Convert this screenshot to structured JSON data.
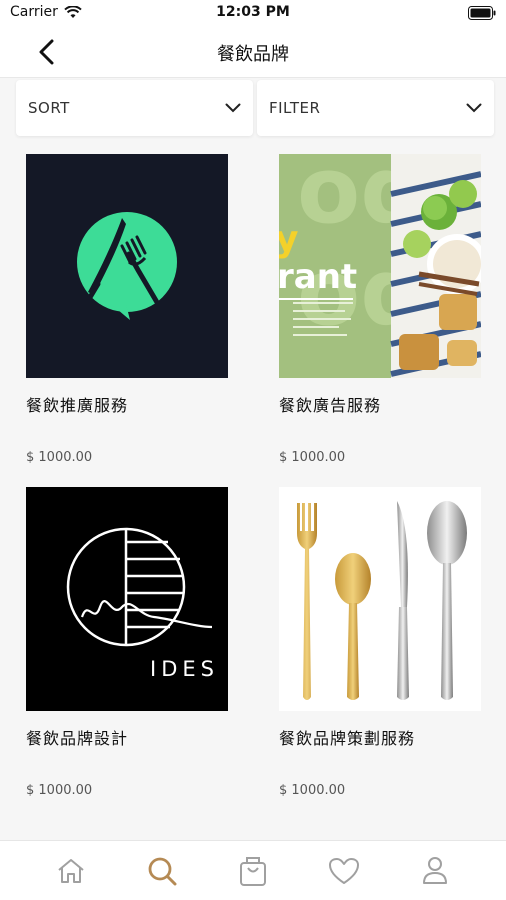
{
  "status_bar": {
    "carrier": "Carrier",
    "time": "12:03 PM"
  },
  "nav": {
    "title": "餐飲品牌"
  },
  "toolbar": {
    "sort_label": "SORT",
    "filter_label": "FILTER"
  },
  "products": [
    {
      "name": "餐飲推廣服務",
      "price": "$ 1000.00",
      "image": "fork-knife-chat-logo"
    },
    {
      "name": "餐飲廣告服務",
      "price": "$ 1000.00",
      "image": "restaurant-ad-flyer",
      "image_text": {
        "line1": "y",
        "line2": "rant"
      }
    },
    {
      "name": "餐飲品牌設計",
      "price": "$ 1000.00",
      "image": "ides-logo",
      "image_text": {
        "logo": "IDES"
      }
    },
    {
      "name": "餐飲品牌策劃服務",
      "price": "$ 1000.00",
      "image": "cutlery-set"
    }
  ],
  "tabs": [
    {
      "icon": "home-icon",
      "active": false
    },
    {
      "icon": "search-icon",
      "active": true
    },
    {
      "icon": "bag-icon",
      "active": false
    },
    {
      "icon": "heart-icon",
      "active": false
    },
    {
      "icon": "user-icon",
      "active": false
    }
  ],
  "colors": {
    "accent": "#b58a54",
    "inactive_icon": "#a0a0a0",
    "logo_green": "#3ddc97",
    "logo_bg": "#141826"
  }
}
